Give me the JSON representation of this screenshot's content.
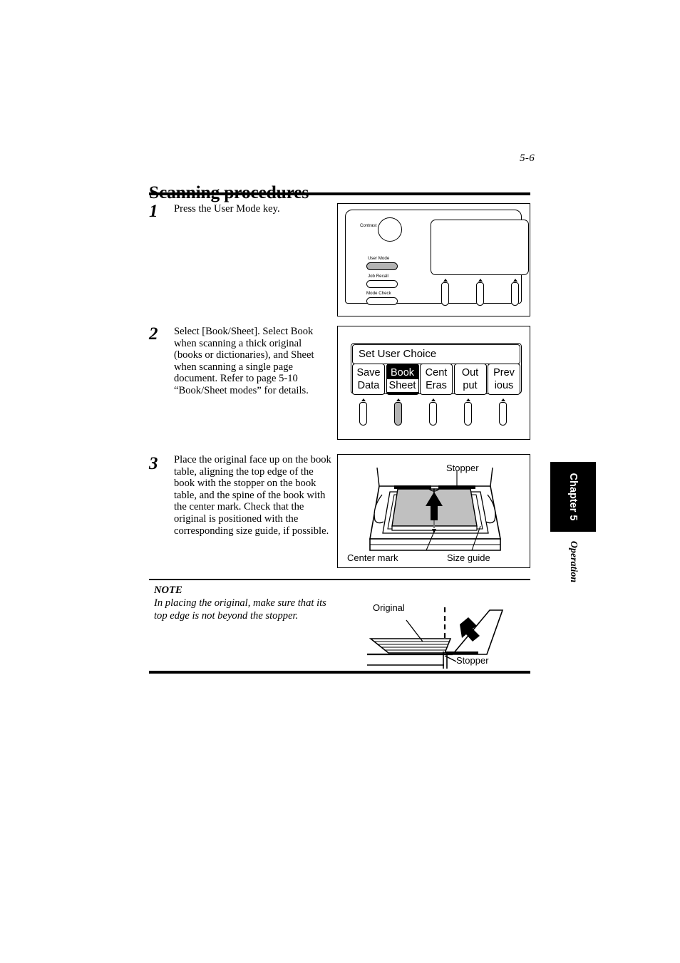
{
  "page": {
    "number": "5-6",
    "title": "Scanning procedures"
  },
  "steps": [
    {
      "number": "1",
      "text": "Press the User Mode key."
    },
    {
      "number": "2",
      "text": "Select [Book/Sheet]. Select Book when scanning a thick original (books or dictionaries), and Sheet when scanning a single page document. Refer to page 5-10 “Book/Sheet modes” for details."
    },
    {
      "number": "3",
      "text": "Place the original face up on the book table, aligning the top edge of the book with the stopper on the book table, and the spine of the book with the center mark.   Check that the original is positioned with the corresponding size guide, if possible."
    }
  ],
  "note": {
    "label": "NOTE",
    "text": "In placing the original, make sure that its top edge is not beyond the stopper."
  },
  "chapter_tab": {
    "label": "Chapter 5",
    "sub_label": "Operation"
  },
  "control_panel": {
    "contrast_label": "Contrast",
    "buttons": [
      {
        "label": "User Mode",
        "highlighted": true
      },
      {
        "label": "Job Recall",
        "highlighted": false
      },
      {
        "label": "Mode Check",
        "highlighted": false
      }
    ]
  },
  "lcd_menu": {
    "title": "Set User Choice",
    "keys": [
      {
        "line1": "Save",
        "line2": "Data",
        "selected": false
      },
      {
        "line1": "Book",
        "line2": "Sheet",
        "selected": true
      },
      {
        "line1": "Cent",
        "line2": "Eras",
        "selected": false
      },
      {
        "line1": "Out",
        "line2": "put",
        "selected": false
      },
      {
        "line1": "Prev",
        "line2": "ious",
        "selected": false
      }
    ]
  },
  "book_table_figure": {
    "labels": {
      "stopper": "Stopper",
      "center_mark": "Center mark",
      "size_guide": "Size guide"
    }
  },
  "note_figure": {
    "labels": {
      "original": "Original",
      "stopper": "Stopper"
    }
  },
  "colors": {
    "highlight_gray": "#b3b3b3",
    "book_gray": "#c0c0c0",
    "ink": "#000000"
  }
}
